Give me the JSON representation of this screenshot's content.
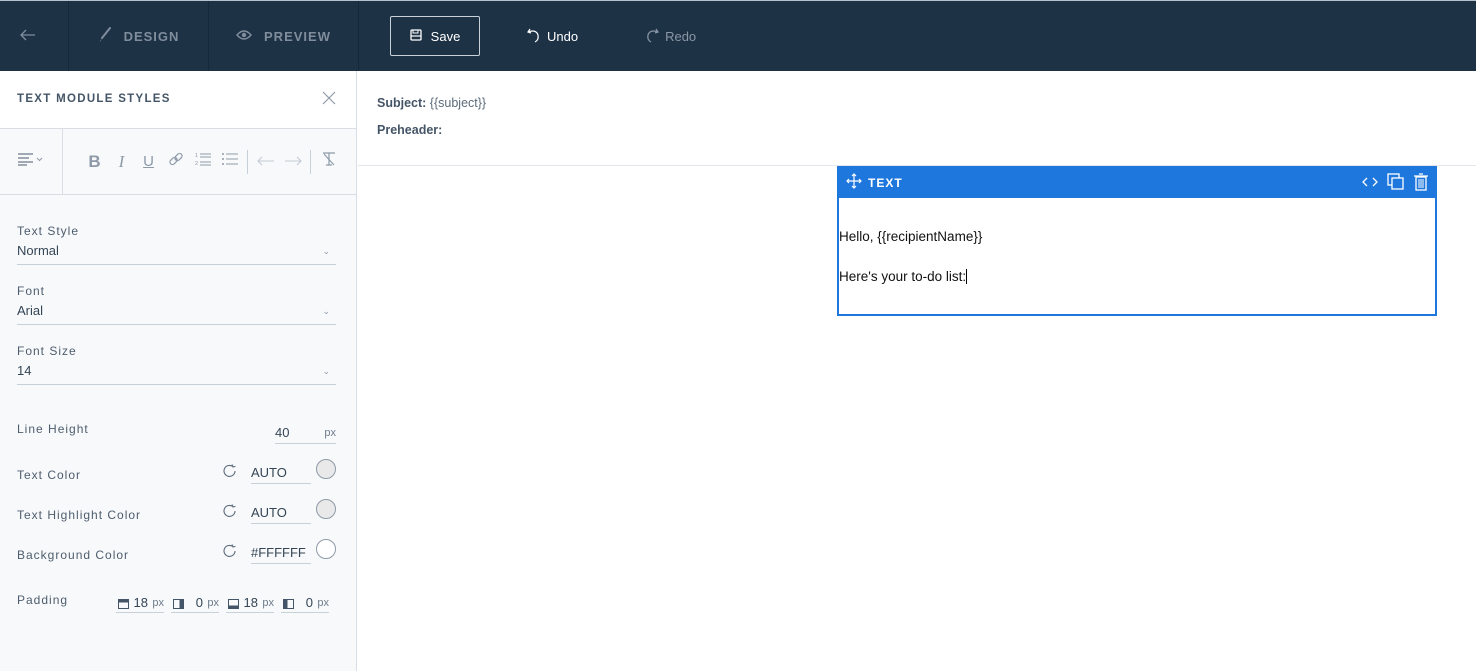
{
  "topbar": {
    "back_icon": "arrow-left-icon",
    "tabs": [
      {
        "label": "DESIGN",
        "icon": "brush-icon"
      },
      {
        "label": "PREVIEW",
        "icon": "eye-icon"
      }
    ],
    "save_label": "Save",
    "undo_label": "Undo",
    "redo_label": "Redo"
  },
  "sidebar": {
    "title": "TEXT MODULE STYLES",
    "toolbar": {
      "align": "align-left-icon",
      "buttons": [
        "bold",
        "italic",
        "underline",
        "link",
        "ordered-list",
        "bullet-list",
        "outdent",
        "indent",
        "clear-format"
      ],
      "bold_glyph": "B",
      "italic_glyph": "I",
      "underline_glyph": "U"
    },
    "text_style": {
      "label": "Text Style",
      "value": "Normal"
    },
    "font": {
      "label": "Font",
      "value": "Arial"
    },
    "font_size": {
      "label": "Font Size",
      "value": "14"
    },
    "line_height": {
      "label": "Line Height",
      "value": "40",
      "unit": "px"
    },
    "text_color": {
      "label": "Text Color",
      "value": "AUTO",
      "swatch": "#e9e9e9"
    },
    "highlight_color": {
      "label": "Text Highlight Color",
      "value": "AUTO",
      "swatch": "#e9e9e9"
    },
    "background_color": {
      "label": "Background Color",
      "value": "#FFFFFF",
      "swatch": "#ffffff"
    },
    "padding": {
      "label": "Padding",
      "top": "18",
      "right": "0",
      "bottom": "18",
      "left": "0",
      "unit": "px"
    }
  },
  "canvas": {
    "subject_label": "Subject:",
    "subject_value": "{{subject}}",
    "preheader_label": "Preheader:",
    "module": {
      "label": "TEXT",
      "line1": "Hello, {{recipientName}}",
      "line2": "Here's your to-do list:",
      "accent": "#1e77dd"
    }
  }
}
